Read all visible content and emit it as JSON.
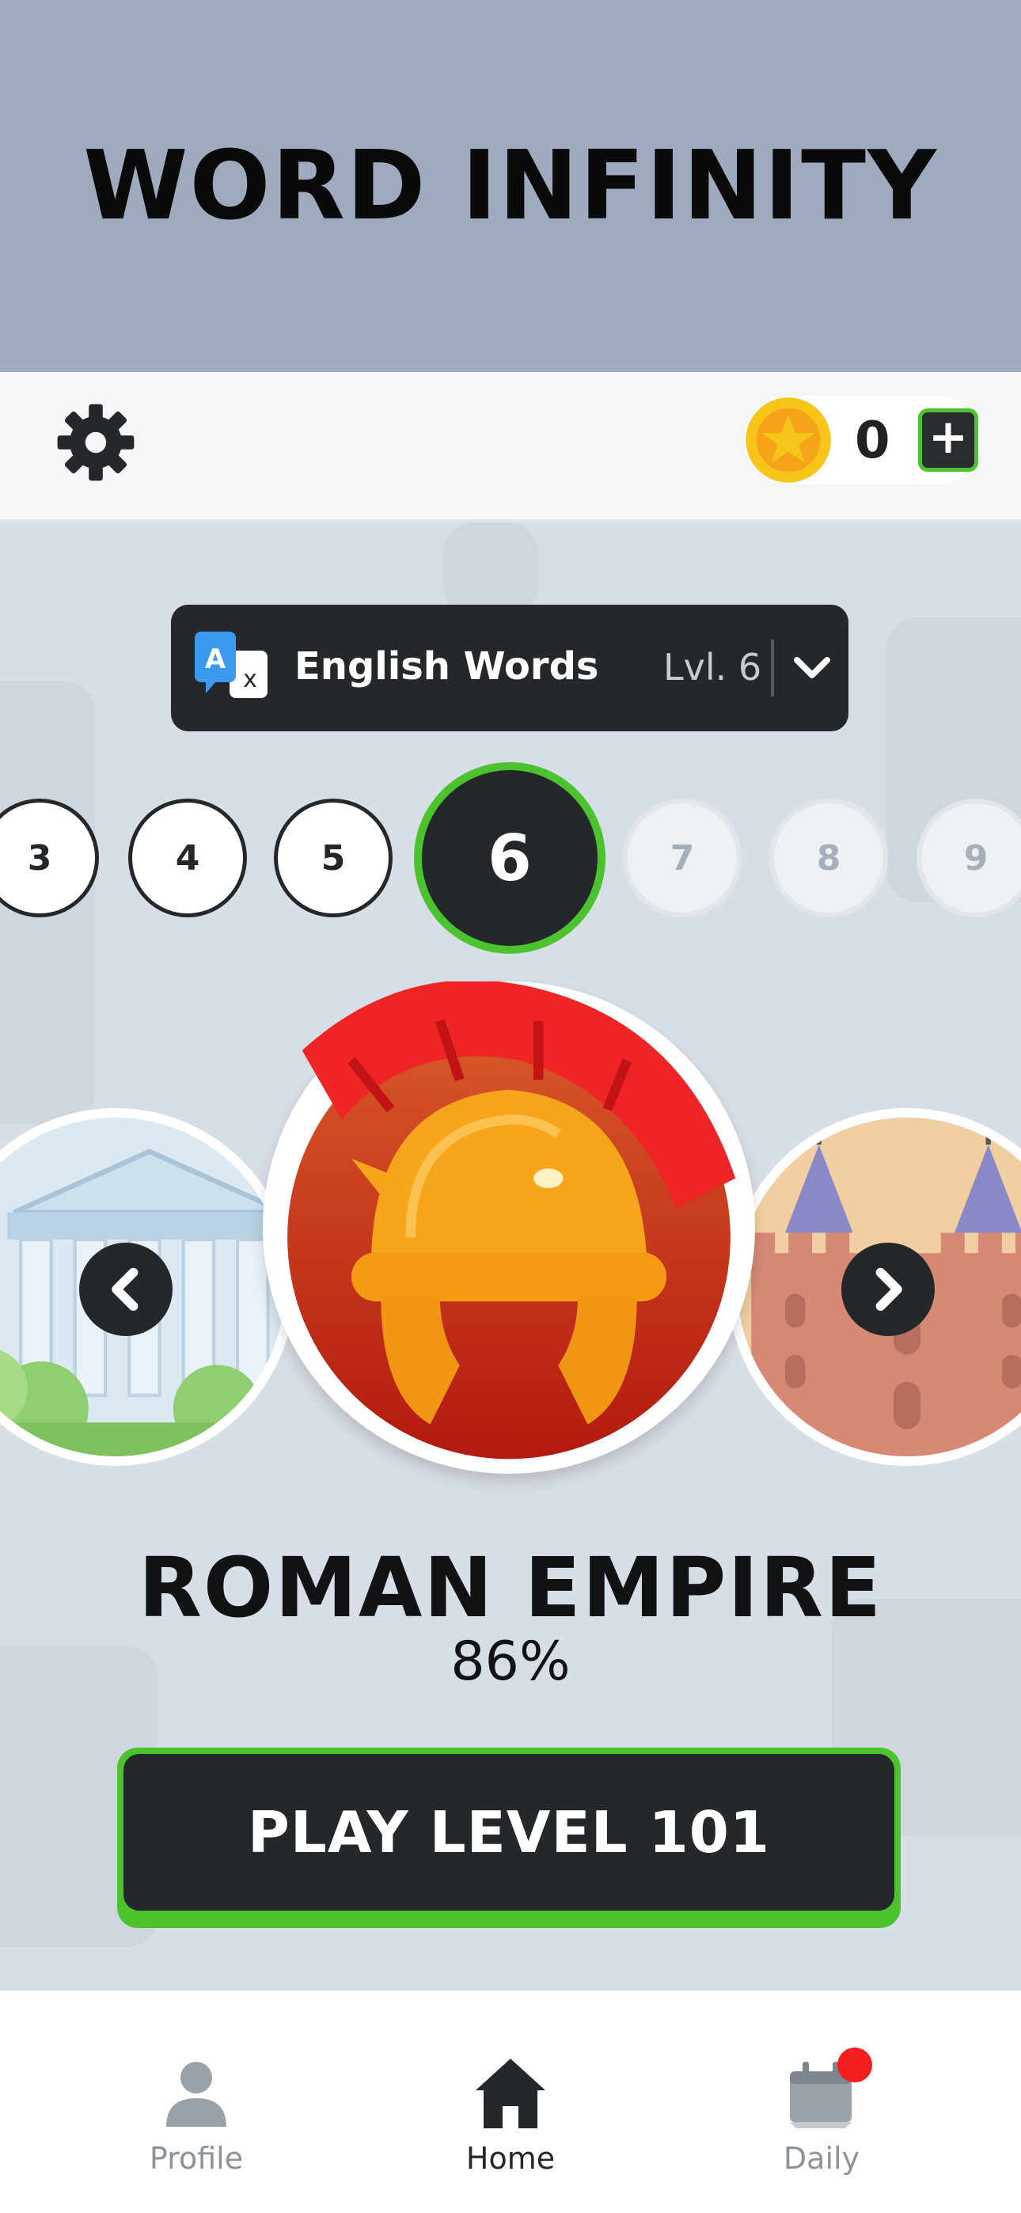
{
  "app": {
    "title": "WORD INFINITY"
  },
  "topbar": {
    "settings_icon": "gear-icon",
    "coins": "0",
    "add_coins_label": "+"
  },
  "language": {
    "name": "English Words",
    "level": "Lvl. 6",
    "icon": "translate-icon"
  },
  "levels": [
    {
      "number": "3",
      "state": "done"
    },
    {
      "number": "4",
      "state": "done"
    },
    {
      "number": "5",
      "state": "done"
    },
    {
      "number": "6",
      "state": "current"
    },
    {
      "number": "7",
      "state": "locked"
    },
    {
      "number": "8",
      "state": "locked"
    },
    {
      "number": "9",
      "state": "locked"
    }
  ],
  "theme": {
    "title": "ROMAN EMPIRE",
    "progress": "86%",
    "icon": "roman-helmet-icon",
    "previous_icon": "greek-temple-icon",
    "next_icon": "castle-icon"
  },
  "play": {
    "label": "PLAY LEVEL 101"
  },
  "bottom_nav": [
    {
      "label": "Profile",
      "icon": "profile-icon",
      "active": false
    },
    {
      "label": "Home",
      "icon": "home-icon",
      "active": true
    },
    {
      "label": "Daily",
      "icon": "calendar-icon",
      "active": false,
      "badge": true
    }
  ],
  "colors": {
    "accent_green": "#4dc22f",
    "dark": "#25282b",
    "banner": "#9eabbf",
    "helmet_red": "#e82a22",
    "helmet_gold": "#f7a51c",
    "notification": "#f41e1e"
  }
}
